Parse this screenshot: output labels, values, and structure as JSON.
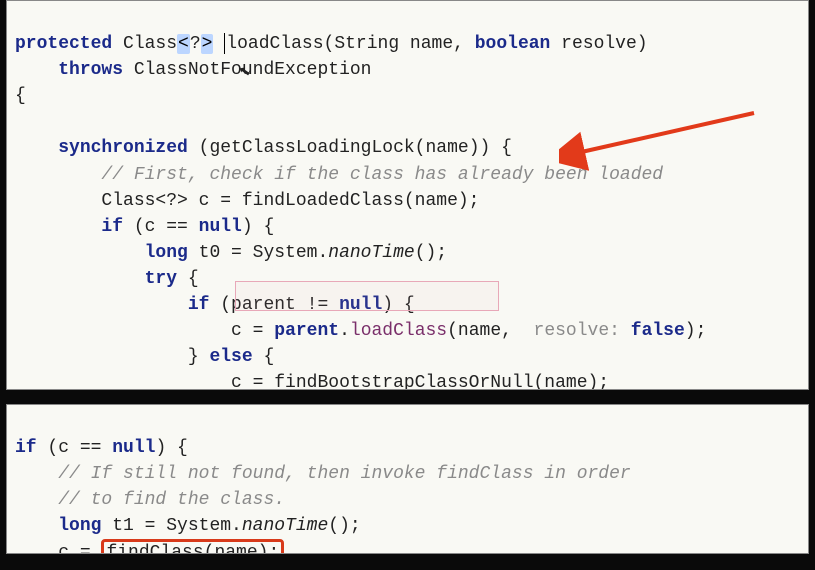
{
  "kw": {
    "protected": "protected",
    "throws": "throws",
    "synchronized": "synchronized",
    "if": "if",
    "else": "else",
    "null": "null",
    "long": "long",
    "try": "try",
    "boolean": "boolean",
    "false": "false"
  },
  "top": {
    "classType": "Class",
    "angleOpen": "<",
    "question": "?",
    "angleClose": ">",
    "loadClass": "loadClass",
    "sigParams": "(String name, ",
    "resolveParam": " resolve)",
    "throwsType": " ClassNotFoundException",
    "openBrace": "{",
    "syncCall": " (getClassLoadingLock(name)) {",
    "comment1": "// First, check if the class has already been loaded",
    "declC": "Class<?> c = findLoadedClass(name);",
    "ifCNull": " (c == ",
    "closeParenBrace": ") {",
    "t0decl": " t0 = System.",
    "nanoTime": "nanoTime",
    "nanoTimeTail": "();",
    "tryBrace": " {",
    "ifParent": " (parent != ",
    "parentLoadLead": "c = ",
    "parentWord": "parent",
    "dot": ".",
    "loadClassWord": "loadClass",
    "parentLoadArgs1": "(name,  ",
    "resolveHint": "resolve:",
    "parentLoadArgs2": " ",
    "parentLoadArgs3": ");",
    "elseBrace": " {",
    "bootstrapLine": "c = findBootstrapClassOrNull(name);",
    "closeBrace": "}"
  },
  "bottom": {
    "ifCNull": " (c == ",
    "closeParenBrace": ") {",
    "comment1": "// If still not found, then invoke findClass in order",
    "comment2": "// to find the class.",
    "t1decl": " t1 = System.",
    "nanoTime": "nanoTime",
    "nanoTimeTail": "();",
    "assignLead": "c = ",
    "findClassCall": "findClass(name);"
  }
}
